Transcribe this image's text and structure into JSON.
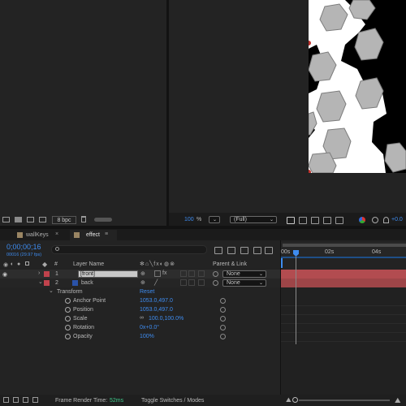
{
  "composition_viewer": {
    "bpc_label": "8 bpc",
    "zoom_value": "100",
    "zoom_unit": "%",
    "resolution": "(Full)",
    "exposure_value": "+0.0",
    "colors": {
      "white": "#ffffff",
      "black": "#000000",
      "hexagon": "#b5b5b5",
      "anchor_red": "#c0312c"
    }
  },
  "tabs": [
    {
      "label": "wallKeys",
      "close": "×",
      "color": "#9a8563"
    },
    {
      "label": "effect",
      "menu": "≡",
      "color": "#9a8563"
    }
  ],
  "timeline": {
    "timecode": "0;00;00;16",
    "frame_info": "00016 (29.97 fps)",
    "search_placeholder": "",
    "columns": {
      "hash": "#",
      "layer_name": "Layer Name",
      "parent_link": "Parent & Link"
    },
    "ruler": {
      "start": "00s",
      "mark1": "02s",
      "mark2": "04s"
    },
    "layers": [
      {
        "index": "1",
        "name": "[front]",
        "parent": "None",
        "label_color": "#c0424c",
        "bar_color": "#b24c50"
      },
      {
        "index": "2",
        "name": "back",
        "parent": "None",
        "label_color": "#c0424c",
        "bar_color": "#9e4548"
      }
    ],
    "transform": {
      "group_label": "Transform",
      "reset_label": "Reset",
      "properties": [
        {
          "name": "Anchor Point",
          "value": "1053.0,497.0"
        },
        {
          "name": "Position",
          "value": "1053.0,497.0"
        },
        {
          "name": "Scale",
          "value": "100.0,100.0%"
        },
        {
          "name": "Rotation",
          "value": "0x+0.0°"
        },
        {
          "name": "Opacity",
          "value": "100%"
        }
      ]
    },
    "footer": {
      "render_label": "Frame Render Time:",
      "render_value": "52ms",
      "toggle_label": "Toggle Switches / Modes"
    }
  }
}
